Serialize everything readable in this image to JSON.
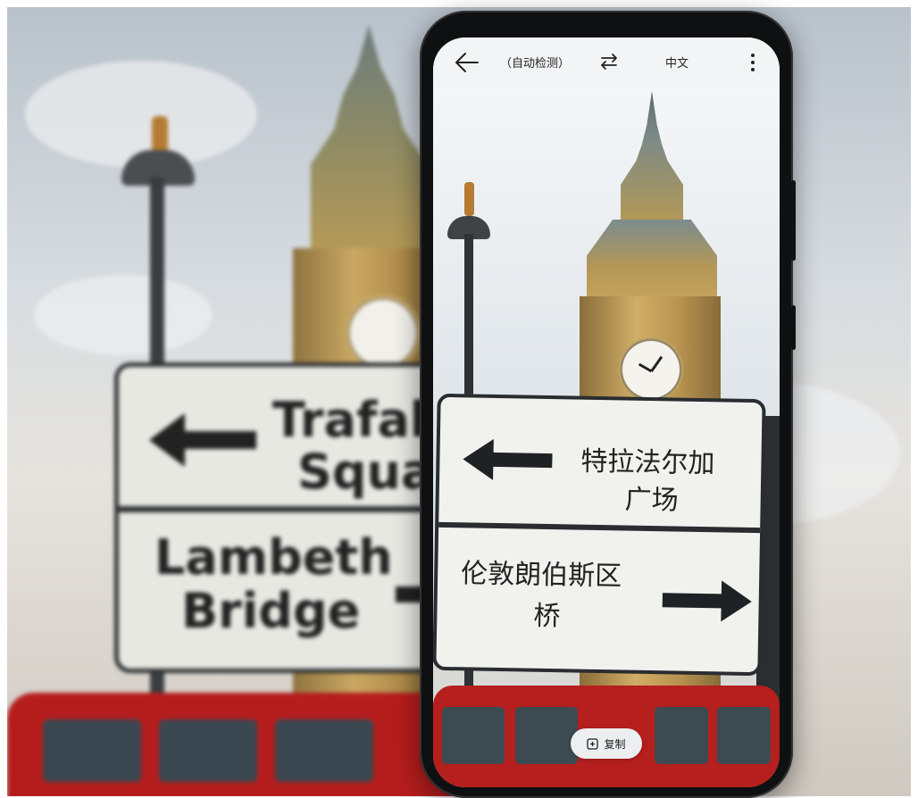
{
  "background": {
    "sign_top_line1": "Trafalg",
    "sign_top_line2": "Squa",
    "sign_bottom_line1": "Lambeth",
    "sign_bottom_line2": "Bridge"
  },
  "topbar": {
    "back_icon": "arrow-left-icon",
    "source_language": "（自动检测）",
    "swap_icon": "swap-arrows-icon",
    "target_language": "中文",
    "menu_icon": "more-vertical-icon"
  },
  "translated_sign": {
    "top_line1": "特拉法尔加",
    "top_line2": "广场",
    "bottom_line1": "伦敦朗伯斯区",
    "bottom_line2": "桥"
  },
  "copy_button": {
    "icon": "copy-icon",
    "label": "复制"
  }
}
